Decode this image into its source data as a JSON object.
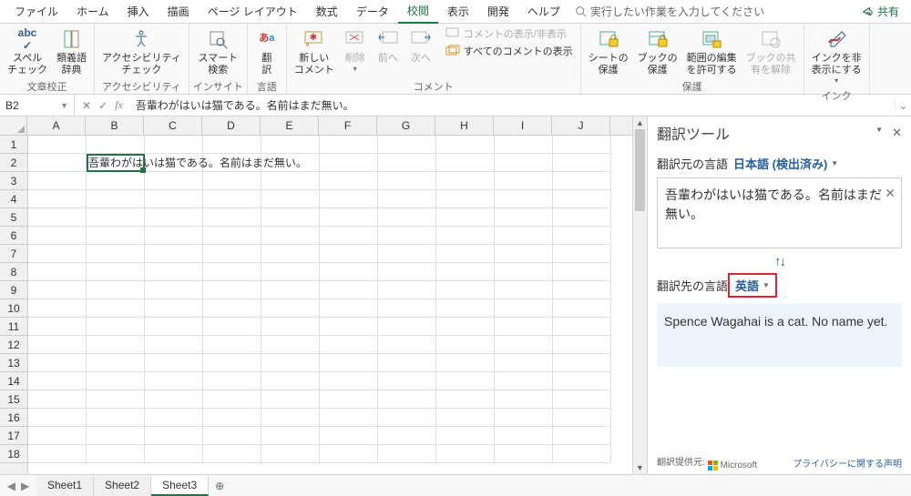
{
  "menu": {
    "tabs": [
      "ファイル",
      "ホーム",
      "挿入",
      "描画",
      "ページ レイアウト",
      "数式",
      "データ",
      "校閲",
      "表示",
      "開発",
      "ヘルプ"
    ],
    "active": 7,
    "searchPlaceholder": "実行したい作業を入力してください",
    "share": "共有"
  },
  "ribbon": {
    "proofing": {
      "spell": "スペル\nチェック",
      "thes": "類義語\n辞典",
      "label": "文章校正"
    },
    "acc": {
      "check": "アクセシビリティ\nチェック",
      "label": "アクセシビリティ"
    },
    "insight": {
      "smart": "スマート\n検索",
      "label": "インサイト"
    },
    "lang": {
      "translate": "翻\n訳",
      "label": "言語"
    },
    "comments": {
      "new": "新しい\nコメント",
      "delete": "削除",
      "prev": "前へ",
      "next": "次へ",
      "show": "コメントの表示/非表示",
      "showall": "すべてのコメントの表示",
      "label": "コメント"
    },
    "protect": {
      "sheet": "シートの\n保護",
      "book": "ブックの\n保護",
      "range": "範囲の編集\nを許可する",
      "unshare": "ブックの共\n有を解除",
      "label": "保護"
    },
    "ink": {
      "hide": "インクを非\n表示にする",
      "label": "インク"
    }
  },
  "formula": {
    "cellRef": "B2",
    "text": "吾輩わがはいは猫である。名前はまだ無い。"
  },
  "grid": {
    "cols": [
      "A",
      "B",
      "C",
      "D",
      "E",
      "F",
      "G",
      "H",
      "I",
      "J"
    ],
    "rowCount": 18,
    "activeCell": {
      "row": 2,
      "col": 2
    },
    "cellB2": "吾輩わがはいは猫である。名前はまだ無い。"
  },
  "translator": {
    "title": "翻訳ツール",
    "srcLabel": "翻訳元の言語",
    "srcLang": "日本語 (検出済み)",
    "srcText": "吾輩わがはいは猫である。名前はまだ無い。",
    "tgtLabel": "翻訳先の言語",
    "tgtLang": "英語",
    "tgtText": "Spence Wagahai is a cat. No name yet.",
    "provider": "翻訳提供元:",
    "providerName": "Microsoft",
    "privacy": "プライバシーに関する声明"
  },
  "sheets": {
    "list": [
      "Sheet1",
      "Sheet2",
      "Sheet3"
    ],
    "active": 2
  }
}
